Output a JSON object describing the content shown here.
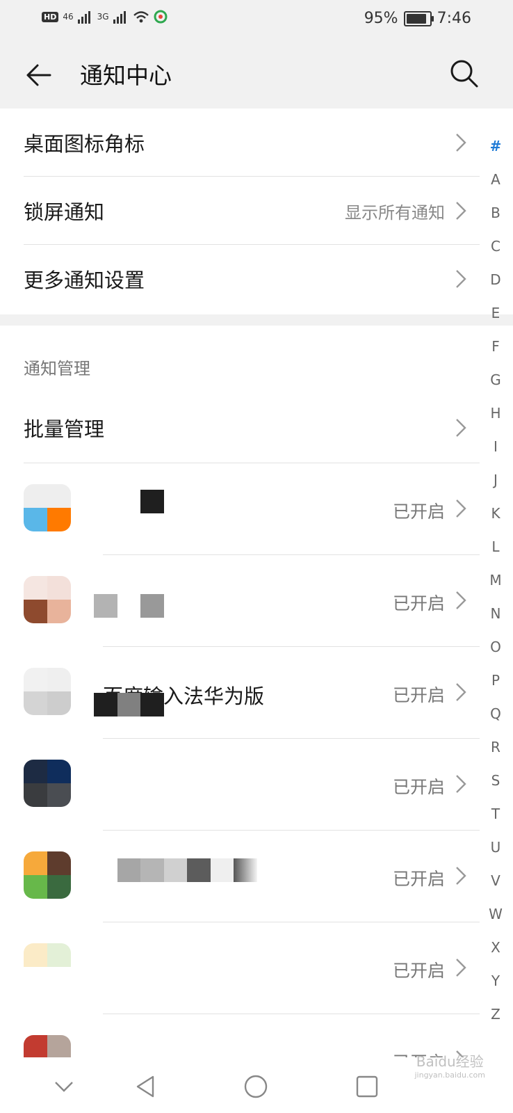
{
  "status_bar": {
    "hd": "HD",
    "signal1": "46",
    "signal2": "3G",
    "battery": "95%",
    "time": "7:46"
  },
  "header": {
    "title": "通知中心"
  },
  "settings": [
    {
      "label": "桌面图标角标",
      "value": ""
    },
    {
      "label": "锁屏通知",
      "value": "显示所有通知"
    },
    {
      "label": "更多通知设置",
      "value": ""
    }
  ],
  "section": {
    "title": "通知管理",
    "batch_label": "批量管理"
  },
  "apps": [
    {
      "name": "",
      "status": "已开启",
      "colors": [
        "#eeeeee",
        "#eeeeee",
        "#5ab7e8",
        "#ff7a00"
      ]
    },
    {
      "name": "",
      "status": "已开启",
      "colors": [
        "#f5e6e1",
        "#f3e0da",
        "#8e4a2e",
        "#e8b39b"
      ]
    },
    {
      "name": "百度输入法华为版",
      "status": "已开启",
      "colors": [
        "#f1f1f1",
        "#efefef",
        "#d4d4d4",
        "#cdcdcd"
      ]
    },
    {
      "name": "",
      "status": "已开启",
      "colors": [
        "#1d2b43",
        "#0f2d5c",
        "#3a3c3f",
        "#4a4d52"
      ]
    },
    {
      "name": "",
      "status": "已开启",
      "colors": [
        "#f6a93b",
        "#5e3c2d",
        "#67b84a",
        "#3a6a3f"
      ]
    },
    {
      "name": "",
      "status": "已开启",
      "colors": [
        "#fbebc7",
        "#e3f0d7",
        "#ffffff",
        "#ffffff"
      ]
    },
    {
      "name": "",
      "status": "已开启",
      "colors": [
        "#c23b30",
        "#b5a49b",
        "#ffffff",
        "#ffffff"
      ]
    }
  ],
  "alpha_index": [
    "#",
    "A",
    "B",
    "C",
    "D",
    "E",
    "F",
    "G",
    "H",
    "I",
    "J",
    "K",
    "L",
    "M",
    "N",
    "O",
    "P",
    "Q",
    "R",
    "S",
    "T",
    "U",
    "V",
    "W",
    "X",
    "Y",
    "Z"
  ],
  "watermark": "Baidu经验",
  "watermark_sub": "jingyan.baidu.com"
}
